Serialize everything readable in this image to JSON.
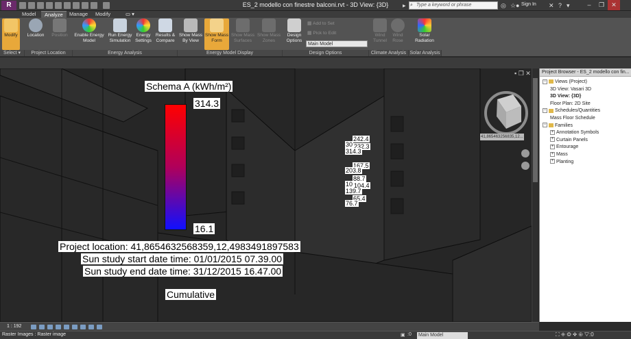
{
  "app": {
    "logo": "R",
    "title": "ES_2 modello con finestre balconi.rvt - 3D View: {3D}",
    "search_placeholder": "Type a keyword or phrase",
    "signin": "Sign In"
  },
  "tabs": [
    {
      "label": "Model",
      "active": false
    },
    {
      "label": "Analyze",
      "active": true
    },
    {
      "label": "Manage",
      "active": false
    },
    {
      "label": "Modify",
      "active": false
    }
  ],
  "ribbon": {
    "select": {
      "label": "Modify",
      "panel": "Select"
    },
    "location": {
      "label": "Location",
      "position": "Position",
      "panel": "Project Location"
    },
    "energy": {
      "enable": "Enable Energy Model",
      "run": "Run Energy Simulation",
      "settings": "Energy Settings",
      "results": "Results & Compare",
      "panel": "Energy Analysis"
    },
    "mass": {
      "by_view": "Show Mass By View",
      "form": "Show Mass Form",
      "surfaces": "Show Mass Surfaces",
      "zones": "Show Mass Zones",
      "panel": "Energy Model Display"
    },
    "design": {
      "options": "Design Options",
      "add_to_set": "Add to Set",
      "pick_to_edit": "Pick to Edit",
      "main_model": "Main Model",
      "panel": "Design Options"
    },
    "climate": {
      "wind_tunnel": "Wind Tunnel",
      "wind_rose": "Wind Rose",
      "panel": "Climate Analysis"
    },
    "solar": {
      "radiation": "Solar Radiation",
      "panel": "Solar Analysis"
    }
  },
  "viewport": {
    "legend_title": "Schema A (kWh/m²)",
    "legend_max": "314.3",
    "legend_min": "16.1",
    "project_location": "Project location: 41,8654632568359,12,4983491897583",
    "start": "Sun study start date time: 01/01/2015 07.39.00",
    "end": "Sun study end date time: 31/12/2015 16.47.00",
    "cumulative": "Cumulative",
    "values": [
      "242.4",
      "30",
      "232.3",
      "314.3",
      "167.5",
      "203.8",
      "88.7",
      "10",
      "104.4",
      "139.7",
      "65.4",
      "76.7"
    ],
    "coord_label": "41,865463256835,12..."
  },
  "browser": {
    "title": "Project Browser - ES_2 modello con fin...",
    "items": [
      {
        "label": "Views (Project)",
        "level": 0,
        "expander": "−"
      },
      {
        "label": "3D View: Vasari 3D",
        "level": 1
      },
      {
        "label": "3D View: {3D}",
        "level": 1,
        "bold": true
      },
      {
        "label": "Floor Plan: 2D Site",
        "level": 1
      },
      {
        "label": "Schedules/Quantities",
        "level": 0,
        "expander": "−"
      },
      {
        "label": "Mass Floor Schedule",
        "level": 1
      },
      {
        "label": "Families",
        "level": 0,
        "expander": "−"
      },
      {
        "label": "Annotation Symbols",
        "level": 1,
        "expander": "+"
      },
      {
        "label": "Curtain Panels",
        "level": 1,
        "expander": "+"
      },
      {
        "label": "Entourage",
        "level": 1,
        "expander": "+"
      },
      {
        "label": "Mass",
        "level": 1,
        "expander": "+"
      },
      {
        "label": "Planting",
        "level": 1,
        "expander": "+"
      }
    ]
  },
  "statusbar": {
    "scale": "1 : 192",
    "status": "Raster Images : Raster image",
    "model": "Main Model",
    "zero": ":0"
  }
}
